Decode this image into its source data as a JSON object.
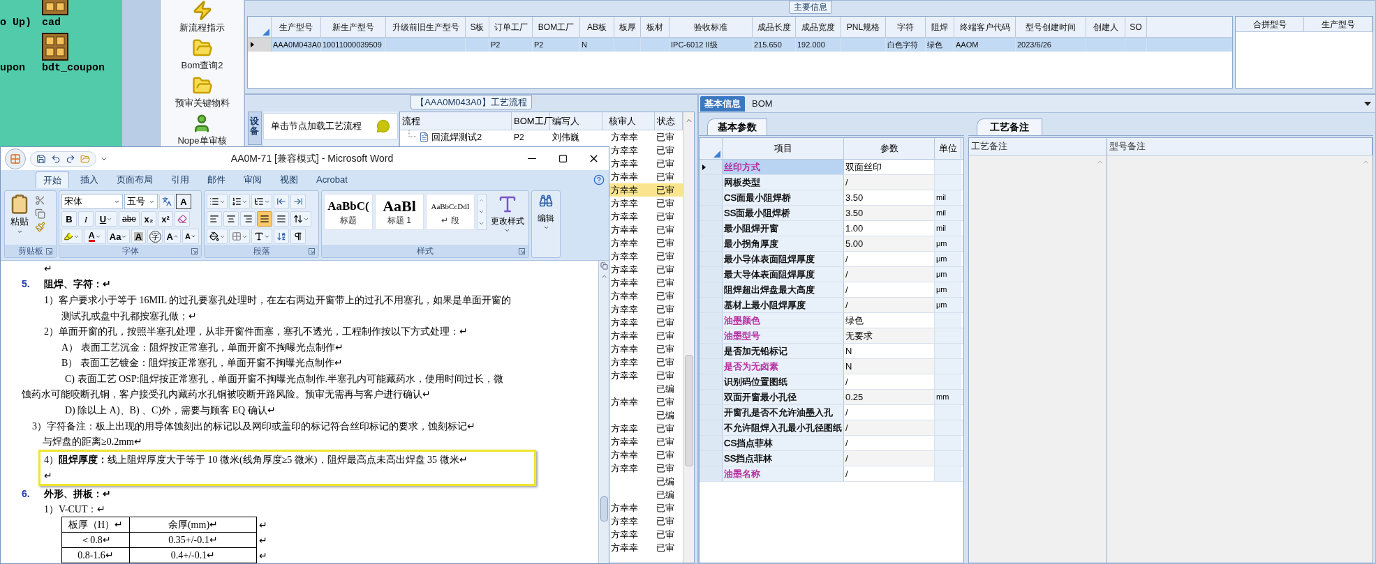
{
  "desktop": {
    "icons": [
      {
        "label": "o Up)",
        "kind": "label"
      },
      {
        "label": "cad",
        "kind": "app"
      },
      {
        "label": "upon",
        "kind": "label"
      },
      {
        "label": "bdt_coupon",
        "kind": "app"
      }
    ]
  },
  "launcher": {
    "items": [
      {
        "label": "新流程指示",
        "kind": "lightning"
      },
      {
        "label": "Bom查询2",
        "kind": "folder"
      },
      {
        "label": "预审关键物料",
        "kind": "folder"
      },
      {
        "label": "Nope单审核",
        "kind": "person"
      }
    ]
  },
  "main_info": {
    "title": "主要信息",
    "columns": [
      "生产型号",
      "新生产型号",
      "升级前旧生产型号",
      "S板",
      "订单工厂",
      "BOM工厂",
      "AB板",
      "板厚",
      "板材",
      "验收标准",
      "成品长度",
      "成品宽度",
      "PNL规格",
      "字符",
      "阻焊",
      "终端客户代码",
      "型号创建时间",
      "创建人",
      "SO"
    ],
    "rows": [
      {
        "selected": true,
        "cells": [
          "AAA0M043A0",
          "10011000039509",
          null,
          null,
          "P2",
          "P2",
          "N",
          null,
          null,
          "IPC-6012 II级",
          "215.650",
          "192.000",
          null,
          "白色字符",
          "绿色",
          "AAOM",
          "2023/6/26",
          null,
          null
        ]
      }
    ],
    "side_columns": [
      "合拼型号",
      "生产型号"
    ]
  },
  "process": {
    "title": "【AAA0M043A0】工艺流程",
    "side_tab": "设备",
    "hint": "单击节点加载工艺流程",
    "columns": [
      "流程",
      "BOM工厂",
      "编写人",
      "核审人",
      "状态"
    ],
    "rows": [
      {
        "name": "回流焊测试2",
        "bom": "P2",
        "writer": "刘伟巍",
        "reviewer": "方幸幸",
        "status": "已审",
        "selected": false
      },
      {
        "reviewer": "方幸幸",
        "status": "已审",
        "selected": false
      },
      {
        "reviewer": "方幸幸",
        "status": "已审",
        "selected": false
      },
      {
        "reviewer": "方幸幸",
        "status": "已审",
        "selected": false
      },
      {
        "reviewer": "方幸幸",
        "status": "已审",
        "selected": true
      },
      {
        "reviewer": "方幸幸",
        "status": "已审",
        "selected": false
      },
      {
        "reviewer": "方幸幸",
        "status": "已审",
        "selected": false
      },
      {
        "reviewer": "方幸幸",
        "status": "已审",
        "selected": false
      },
      {
        "reviewer": "方幸幸",
        "status": "已审",
        "selected": false
      },
      {
        "reviewer": "方幸幸",
        "status": "已审",
        "selected": false
      },
      {
        "reviewer": "方幸幸",
        "status": "已审",
        "selected": false
      },
      {
        "reviewer": "方幸幸",
        "status": "已审",
        "selected": false
      },
      {
        "reviewer": "方幸幸",
        "status": "已审",
        "selected": false
      },
      {
        "reviewer": "方幸幸",
        "status": "已审",
        "selected": false
      },
      {
        "reviewer": "方幸幸",
        "status": "已审",
        "selected": false
      },
      {
        "reviewer": "方幸幸",
        "status": "已审",
        "selected": false
      },
      {
        "reviewer": "方幸幸",
        "status": "已审",
        "selected": false
      },
      {
        "reviewer": "方幸幸",
        "status": "已审",
        "selected": false
      },
      {
        "reviewer": "方幸幸",
        "status": "已审",
        "selected": false
      },
      {
        "status": "已编",
        "selected": false
      },
      {
        "reviewer": "方幸幸",
        "status": "已审",
        "selected": false
      },
      {
        "status": "已编",
        "selected": false
      },
      {
        "reviewer": "方幸幸",
        "status": "已审",
        "selected": false
      },
      {
        "reviewer": "方幸幸",
        "status": "已审",
        "selected": false
      },
      {
        "reviewer": "方幸幸",
        "status": "已审",
        "selected": false
      },
      {
        "reviewer": "方幸幸",
        "status": "已审",
        "selected": false
      },
      {
        "status": "已编",
        "selected": false
      },
      {
        "status": "已编",
        "selected": false
      },
      {
        "reviewer": "方幸幸",
        "status": "已审",
        "selected": false
      },
      {
        "reviewer": "方幸幸",
        "status": "已审",
        "selected": false
      },
      {
        "reviewer": "方幸幸",
        "status": "已审",
        "selected": false
      },
      {
        "reviewer": "方幸幸",
        "status": "已审",
        "selected": false
      }
    ]
  },
  "detail": {
    "tabs": [
      {
        "label": "基本信息",
        "selected": true
      },
      {
        "label": "BOM",
        "selected": false
      }
    ],
    "params": {
      "tab": "基本参数",
      "columns": [
        "项目",
        "参数",
        "单位"
      ],
      "rows": [
        {
          "item": "丝印方式",
          "value": "双面丝印",
          "color": "#b5229a",
          "selected": true
        },
        {
          "item": "网板类型",
          "value": "/",
          "color": "#000000",
          "selected": false
        },
        {
          "item": "CS面最小阻焊桥",
          "value": "3.50",
          "unit": "mil",
          "color": "#000000",
          "selected": false
        },
        {
          "item": "SS面最小阻焊桥",
          "value": "3.50",
          "unit": "mil",
          "color": "#000000",
          "selected": false
        },
        {
          "item": "最小阻焊开窗",
          "value": "1.00",
          "unit": "mil",
          "color": "#000000",
          "selected": false
        },
        {
          "item": "最小拐角厚度",
          "value": "5.00",
          "unit": "μm",
          "color": "#000000",
          "selected": false
        },
        {
          "item": "最小导体表面阻焊厚度",
          "value": "/",
          "unit": "μm",
          "color": "#000000",
          "selected": false
        },
        {
          "item": "最大导体表面阻焊厚度",
          "value": "/",
          "unit": "μm",
          "color": "#000000",
          "selected": false
        },
        {
          "item": "阻焊超出焊盘最大高度",
          "value": "/",
          "unit": "μm",
          "color": "#000000",
          "selected": false
        },
        {
          "item": "基材上最小阻焊厚度",
          "value": "/",
          "unit": "μm",
          "color": "#000000",
          "selected": false
        },
        {
          "item": "油墨颜色",
          "value": "绿色",
          "color": "#b5229a",
          "selected": false
        },
        {
          "item": "油墨型号",
          "value": "无要求",
          "color": "#b5229a",
          "selected": false
        },
        {
          "item": "是否加无铅标记",
          "value": "N",
          "color": "#000000",
          "selected": false
        },
        {
          "item": "是否为无卤素",
          "value": "N",
          "color": "#b5229a",
          "selected": false
        },
        {
          "item": "识别码位置图纸",
          "value": "/",
          "color": "#000000",
          "selected": false
        },
        {
          "item": "双面开窗最小孔径",
          "value": "0.25",
          "unit": "mm",
          "color": "#000000",
          "selected": false
        },
        {
          "item": "开窗孔是否不允许油墨入孔",
          "value": "/",
          "color": "#000000",
          "selected": false
        },
        {
          "item": "不允许阻焊入孔最小孔径图纸",
          "value": "/",
          "color": "#000000",
          "selected": false
        },
        {
          "item": "CS挡点菲林",
          "value": "/",
          "color": "#000000",
          "selected": false
        },
        {
          "item": "SS挡点菲林",
          "value": "/",
          "color": "#000000",
          "selected": false
        },
        {
          "item": "油墨名称",
          "value": "/",
          "color": "#b5229a",
          "selected": false
        }
      ]
    },
    "notes": {
      "tab": "工艺备注",
      "columns": [
        "工艺备注",
        "型号备注"
      ]
    }
  },
  "word": {
    "title": "AA0M-71 [兼容模式] - Microsoft Word",
    "tabs": [
      {
        "label": "开始",
        "selected": true
      },
      {
        "label": "插入",
        "selected": false
      },
      {
        "label": "页面布局",
        "selected": false
      },
      {
        "label": "引用",
        "selected": false
      },
      {
        "label": "邮件",
        "selected": false
      },
      {
        "label": "审阅",
        "selected": false
      },
      {
        "label": "视图",
        "selected": false
      },
      {
        "label": "Acrobat",
        "selected": false
      }
    ],
    "ribbon": {
      "clipboard": {
        "paste": "粘贴",
        "label": "剪贴板"
      },
      "font": {
        "label": "字体",
        "font_name": "宋体",
        "font_size": "五号",
        "row1": [
          {
            "label": "A",
            "kind": "border"
          }
        ],
        "row2": [
          {
            "label": "B",
            "kind": "bold"
          },
          {
            "label": "I",
            "kind": "italic"
          },
          {
            "label": "U",
            "kind": "underline"
          },
          {
            "label": "abe",
            "kind": "strike"
          },
          {
            "label": "x₂",
            "kind": "plain"
          },
          {
            "label": "x²",
            "kind": "plain"
          }
        ],
        "row3": [
          {
            "label": "A",
            "kind": "color"
          },
          {
            "label": "Aa",
            "kind": "case"
          },
          {
            "label": "A",
            "kind": "shade"
          },
          {
            "label": "字",
            "kind": "enclose"
          },
          {
            "label": "A",
            "kind": "grow"
          },
          {
            "label": "A",
            "kind": "shrink"
          }
        ]
      },
      "paragraph": {
        "label": "段落",
        "alignment": [
          {
            "selected": false
          },
          {
            "selected": false
          },
          {
            "selected": false
          },
          {
            "selected": true
          },
          {
            "selected": false
          }
        ]
      },
      "styles": {
        "label": "样式",
        "change": "更改样式",
        "tiles": [
          {
            "sample": "AaBbC(",
            "name": "标题",
            "kind": "title"
          },
          {
            "sample": "AaBl",
            "name": "标题 1",
            "kind": "heading"
          },
          {
            "sample": "AaBbCcDdI",
            "name": "↵ 段",
            "kind": "body"
          }
        ]
      },
      "editing": {
        "label": "编辑"
      }
    },
    "document": [
      {
        "kind": "item",
        "text": "↵"
      },
      {
        "kind": "heading",
        "number": "5.",
        "text": "阻焊、字符：↵"
      },
      {
        "kind": "item",
        "text": "1）客户要求小于等于 16MIL 的过孔要塞孔处理时，在左右两边开窗带上的过孔不用塞孔，如果是单面开窗的"
      },
      {
        "kind": "cont",
        "text": "测试孔或盘中孔都按塞孔做；↵"
      },
      {
        "kind": "item",
        "text": "2）单面开窗的孔，按照半塞孔处理，从非开窗件面塞，塞孔不透光，工程制作按以下方式处理：↵"
      },
      {
        "kind": "cont",
        "text": "A） 表面工艺沉金：阻焊按正常塞孔，单面开窗不掏曝光点制作↵"
      },
      {
        "kind": "cont",
        "text": "B） 表面工艺镀金：阻焊按正常塞孔，单面开窗不掏曝光点制作↵"
      },
      {
        "kind": "sub",
        "text": "C)  表面工艺 OSP:阻焊按正常塞孔，单面开窗不掏曝光点制作.半塞孔内可能藏药水，使用时间过长，微"
      },
      {
        "kind": "wrap",
        "text": "蚀药水可能咬断孔铜，客户接受孔内藏药水孔铜被咬断开路风险。预审无需再与客户进行确认↵"
      },
      {
        "kind": "sub",
        "text": "D) 除以上 A)、B) 、C)外，需要与顾客 EQ 确认↵"
      },
      {
        "kind": "note",
        "text": "3）字符备注：板上出现的用导体蚀刻出的标记以及网印或盖印的标记符合丝印标记的要求，蚀刻标记↵"
      },
      {
        "kind": "note_cont",
        "text": "与焊盘的距离≥0.2mm↵"
      },
      {
        "kind": "framed",
        "lines": [
          "4）**阻焊厚度：**线上阻焊厚度大于等于 10 微米(线角厚度≥5 微米)，阻焊最高点未高出焊盘 35 微米↵",
          "↵"
        ]
      },
      {
        "kind": "heading",
        "number": "6.",
        "text": "外形、拼板：↵"
      },
      {
        "kind": "item",
        "text": "1）V-CUT：↵"
      },
      {
        "kind": "table",
        "rows": [
          {
            "cells": [
              "板厚（H）↵",
              "余厚(mm)↵"
            ],
            "mark": "↵"
          },
          {
            "cells": [
              "＜0.8↵",
              "0.35+/-0.1↵"
            ],
            "mark": "↵"
          },
          {
            "cells": [
              "0.8-1.6↵",
              "0.4+/-0.1↵"
            ],
            "mark": "↵"
          }
        ]
      }
    ]
  }
}
